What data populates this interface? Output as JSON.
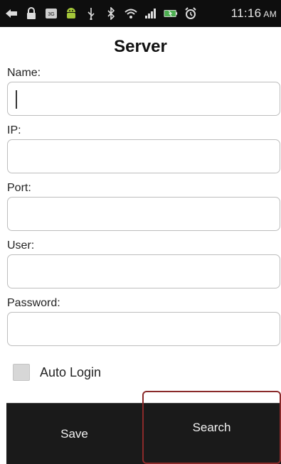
{
  "statusbar": {
    "icons": [
      "back-icon",
      "lock-icon",
      "3g-icon",
      "android-icon",
      "usb-icon",
      "bluetooth-icon",
      "wifi-icon",
      "signal-icon",
      "battery-icon",
      "alarm-icon"
    ],
    "time": "11:16",
    "ampm": "AM"
  },
  "title": "Server",
  "form": {
    "name_label": "Name:",
    "name_value": "",
    "ip_label": "IP:",
    "ip_value": "",
    "port_label": "Port:",
    "port_value": "",
    "user_label": "User:",
    "user_value": "",
    "password_label": "Password:",
    "password_value": ""
  },
  "auto_login": {
    "label": "Auto Login",
    "checked": false
  },
  "buttons": {
    "save": "Save",
    "search": "Search"
  },
  "colors": {
    "statusbar": "#0e0e0e",
    "buttonbar": "#1a1a1a",
    "highlight": "#8a2a2a"
  }
}
